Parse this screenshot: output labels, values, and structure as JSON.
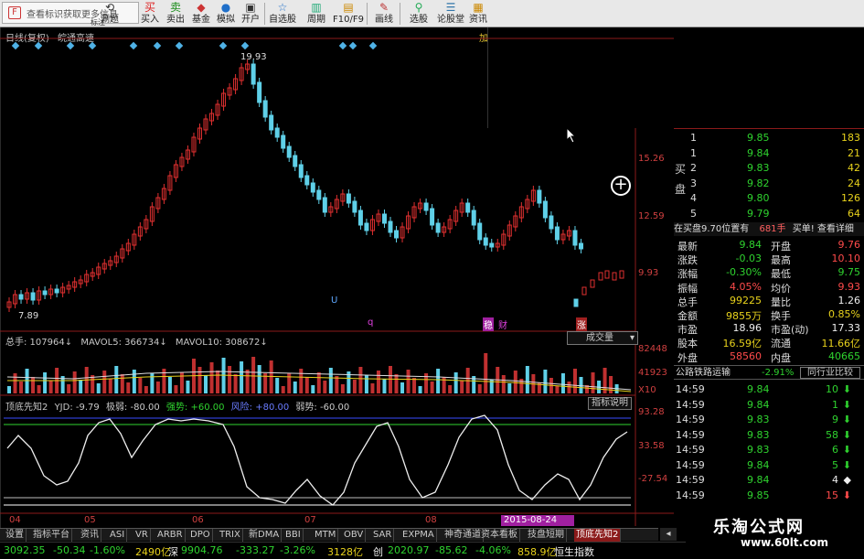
{
  "toolbar": {
    "search_placeholder": "查看标识获取更多信息",
    "search_sub": "标注",
    "search_badge": "F",
    "buttons": [
      {
        "label": "涮题",
        "icon": "refresh-icon"
      },
      {
        "label": "买入",
        "icon": "buy-icon"
      },
      {
        "label": "卖出",
        "icon": "sell-icon"
      },
      {
        "label": "基金",
        "icon": "fund-icon"
      },
      {
        "label": "模拟",
        "icon": "simulate-icon"
      },
      {
        "label": "开户",
        "icon": "account-icon"
      },
      {
        "label": "自选股",
        "icon": "watchlist-icon"
      },
      {
        "label": "周期",
        "icon": "period-icon"
      },
      {
        "label": "F10/F9",
        "icon": "f10-icon"
      },
      {
        "label": "画线",
        "icon": "draw-line-icon"
      },
      {
        "label": "选股",
        "icon": "stock-picker-icon"
      },
      {
        "label": "论股堂",
        "icon": "forum-icon"
      },
      {
        "label": "资讯",
        "icon": "news-icon"
      }
    ]
  },
  "chart": {
    "title": "日线(复权)",
    "stock_name": "皖通高速",
    "right_marker": "加",
    "peak_label": "19.93",
    "low_label": "7.89",
    "price_axis": [
      "15.26",
      "12.59",
      "9.93"
    ],
    "volume_header": {
      "total": "总手: 107964",
      "ma5": "MAVOL5: 366734",
      "ma10": "MAVOL10: 308672"
    },
    "volume_dropdown": "成交量",
    "volume_axis": [
      "82448",
      "41923",
      "X10"
    ],
    "indicator_header": {
      "name": "顶底先知2",
      "yjd": "YJD: -9.79",
      "jr": "极弱: -80.00",
      "ql": "强势: +60.00",
      "fx": "风险: +80.00",
      "rs": "弱势: -60.00"
    },
    "indicator_button": "指标说明",
    "indicator_axis": [
      "93.28",
      "33.58",
      "-27.54"
    ],
    "month_labels": [
      "04",
      "05",
      "06",
      "07",
      "08"
    ],
    "date_badge": "2015-08-24",
    "chart_markers": [
      "U",
      "q",
      "稳",
      "财",
      "涨"
    ]
  },
  "orderbook": {
    "side_label_buy": "买盘",
    "rows": [
      {
        "level": "1",
        "price": "9.85",
        "vol": "183"
      },
      {
        "level": "1",
        "price": "9.84",
        "vol": "21"
      },
      {
        "level": "2",
        "price": "9.83",
        "vol": "42"
      },
      {
        "level": "3",
        "price": "9.82",
        "vol": "24"
      },
      {
        "level": "4",
        "price": "9.80",
        "vol": "126"
      },
      {
        "level": "5",
        "price": "9.79",
        "vol": "64"
      }
    ],
    "banner_left": "在买盘9.70位置有",
    "banner_mid": "681手",
    "banner_right": "买单! 查看详细"
  },
  "quote": {
    "rows": [
      {
        "k1": "最新",
        "v1": "9.84",
        "k2": "开盘",
        "v2": "9.76"
      },
      {
        "k1": "涨跌",
        "v1": "-0.03",
        "k2": "最高",
        "v2": "10.10"
      },
      {
        "k1": "涨幅",
        "v1": "-0.30%",
        "k2": "最低",
        "v2": "9.75"
      },
      {
        "k1": "振幅",
        "v1": "4.05%",
        "k2": "均价",
        "v2": "9.93"
      },
      {
        "k1": "总手",
        "v1": "99225",
        "k2": "量比",
        "v2": "1.26"
      },
      {
        "k1": "金额",
        "v1": "9855万",
        "k2": "换手",
        "v2": "0.85%"
      },
      {
        "k1": "市盈",
        "v1": "18.96",
        "k2": "市盈(动)",
        "v2": "17.33"
      },
      {
        "k1": "股本",
        "v1": "16.59亿",
        "k2": "流通",
        "v2": "11.66亿"
      },
      {
        "k1": "外盘",
        "v1": "58560",
        "k2": "内盘",
        "v2": "40665"
      }
    ],
    "sector_name": "公路铁路运输",
    "sector_change": "-2.91%",
    "sector_button": "同行业比较"
  },
  "ticks": [
    {
      "time": "14:59",
      "price": "9.84",
      "vol": "10",
      "dir": "down"
    },
    {
      "time": "14:59",
      "price": "9.84",
      "vol": "1",
      "dir": "down"
    },
    {
      "time": "14:59",
      "price": "9.83",
      "vol": "9",
      "dir": "down"
    },
    {
      "time": "14:59",
      "price": "9.83",
      "vol": "58",
      "dir": "down"
    },
    {
      "time": "14:59",
      "price": "9.83",
      "vol": "6",
      "dir": "down"
    },
    {
      "time": "14:59",
      "price": "9.84",
      "vol": "5",
      "dir": "down"
    },
    {
      "time": "14:59",
      "price": "9.84",
      "vol": "4",
      "dir": "flat"
    },
    {
      "time": "14:59",
      "price": "9.85",
      "vol": "15",
      "dir": "down"
    }
  ],
  "bottom_tabs": [
    "设置",
    "指标平台",
    "资讯",
    "ASI",
    "VR",
    "ARBR",
    "DPO",
    "TRIX",
    "新DMA",
    "BBI",
    "MTM",
    "OBV",
    "SAR",
    "EXPMA",
    "神奇通道",
    "资本看板",
    "技盘短期",
    "顶底先知2"
  ],
  "statusbar": [
    {
      "text": "3092.35",
      "color": "green"
    },
    {
      "text": "-50.34",
      "color": "green"
    },
    {
      "text": "-1.60%",
      "color": "green"
    },
    {
      "text": "2490亿",
      "color": "yellow"
    },
    {
      "text": "深",
      "color": "white"
    },
    {
      "text": "9904.76",
      "color": "green"
    },
    {
      "text": "-333.27",
      "color": "green"
    },
    {
      "text": "-3.26%",
      "color": "green"
    },
    {
      "text": "3128亿",
      "color": "yellow"
    },
    {
      "text": "创",
      "color": "white"
    },
    {
      "text": "2020.97",
      "color": "green"
    },
    {
      "text": "-85.62",
      "color": "green"
    },
    {
      "text": "-4.06%",
      "color": "green"
    },
    {
      "text": "858.9亿",
      "color": "yellow"
    },
    {
      "text": "恒生指数",
      "color": "white"
    }
  ],
  "watermark": {
    "title": "乐淘公式网",
    "url": "www.60lt.com"
  }
}
